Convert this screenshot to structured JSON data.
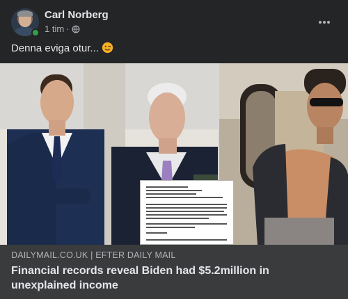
{
  "post": {
    "author_name": "Carl Norberg",
    "timestamp": "1 tim",
    "separator": "·",
    "privacy_icon": "globe-icon",
    "more_icon": "more-options-icon",
    "text": "Denna eviga otur...",
    "emoji_icon": "winking-face-emoji"
  },
  "link_preview": {
    "domain": "DAILYMAIL.CO.UK | EFTER DAILY MAIL",
    "title": "Financial records reveal Biden had $5.2million in unexplained income"
  },
  "colors": {
    "background": "#242526",
    "link_preview_background": "#3a3b3c",
    "primary_text": "#e4e6eb",
    "secondary_text": "#b0b3b8",
    "online_status": "#31a24c"
  }
}
